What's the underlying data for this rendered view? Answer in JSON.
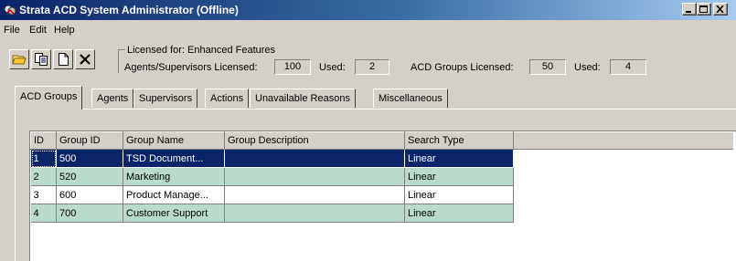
{
  "window": {
    "title": "Strata ACD System Administrator (Offline)"
  },
  "menu": [
    "File",
    "Edit",
    "Help"
  ],
  "toolbar": {
    "icons": [
      "open-folder-icon",
      "copy-icon",
      "new-document-icon",
      "delete-icon"
    ]
  },
  "license": {
    "title": "Licensed for: Enhanced Features",
    "agents_label": "Agents/Supervisors Licensed:",
    "agents_licensed": "100",
    "agents_used_label": "Used:",
    "agents_used": "2",
    "groups_label": "ACD Groups Licensed:",
    "groups_licensed": "50",
    "groups_used_label": "Used:",
    "groups_used": "4"
  },
  "tabs": [
    "ACD Groups",
    "Agents",
    "Supervisors",
    "Actions",
    "Unavailable Reasons",
    "Miscellaneous"
  ],
  "active_tab": "ACD Groups",
  "table": {
    "columns": [
      "ID",
      "Group ID",
      "Group Name",
      "Group Description",
      "Search Type"
    ],
    "rows": [
      [
        "1",
        "500",
        "TSD Document...",
        "",
        "Linear"
      ],
      [
        "2",
        "520",
        "Marketing",
        "",
        "Linear"
      ],
      [
        "3",
        "600",
        "Product Manage...",
        "",
        "Linear"
      ],
      [
        "4",
        "700",
        "Customer Support",
        "",
        "Linear"
      ]
    ],
    "selected_row": 0
  },
  "colors": {
    "titlebar": "#0a246a",
    "selection": "#0a246a",
    "alt_row": "#b9dbcb",
    "face": "#d4d0c8"
  }
}
